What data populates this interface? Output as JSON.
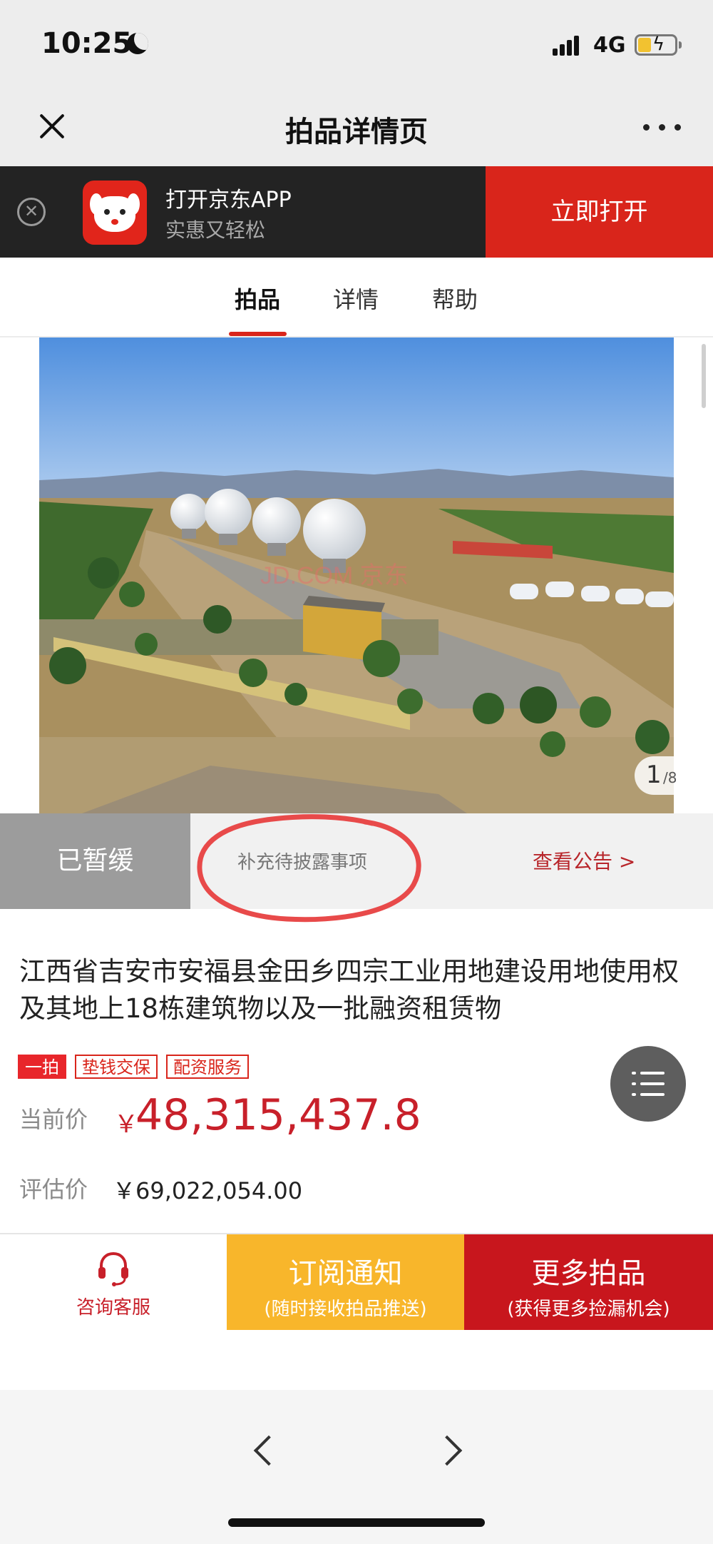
{
  "status_bar": {
    "time": "10:25",
    "network": "4G"
  },
  "nav": {
    "title": "拍品详情页"
  },
  "app_banner": {
    "title": "打开京东APP",
    "subtitle": "实惠又轻松",
    "open_label": "立即打开"
  },
  "tabs": [
    {
      "label": "拍品",
      "active": true
    },
    {
      "label": "详情",
      "active": false
    },
    {
      "label": "帮助",
      "active": false
    }
  ],
  "photo": {
    "watermark": "JD.COM 京东",
    "current": "1",
    "total": "/8"
  },
  "auction_status": {
    "badge": "已暂缓",
    "supplement": "补充待披露事项",
    "view_notice": "查看公告 >"
  },
  "item": {
    "title": "江西省吉安市安福县金田乡四宗工业用地建设用地使用权及其地上18栋建筑物以及一批融资租赁物",
    "tags": [
      "一拍",
      "垫钱交保",
      "配资服务"
    ],
    "current_price_label": "当前价",
    "currency": "￥",
    "current_price": "48,315,437.8",
    "evaluation_label": "评估价",
    "evaluation_price": "￥69,022,054.00"
  },
  "actions": {
    "service_label": "咨询客服",
    "subscribe_title": "订阅通知",
    "subscribe_sub": "(随时接收拍品推送)",
    "more_title": "更多拍品",
    "more_sub": "(获得更多捡漏机会)"
  },
  "colors": {
    "jd_red": "#d9251b",
    "price_red": "#c8202a",
    "subscribe_yellow": "#f8b62b",
    "banner_dark": "#232323",
    "annotation_red": "#e84a4a"
  }
}
